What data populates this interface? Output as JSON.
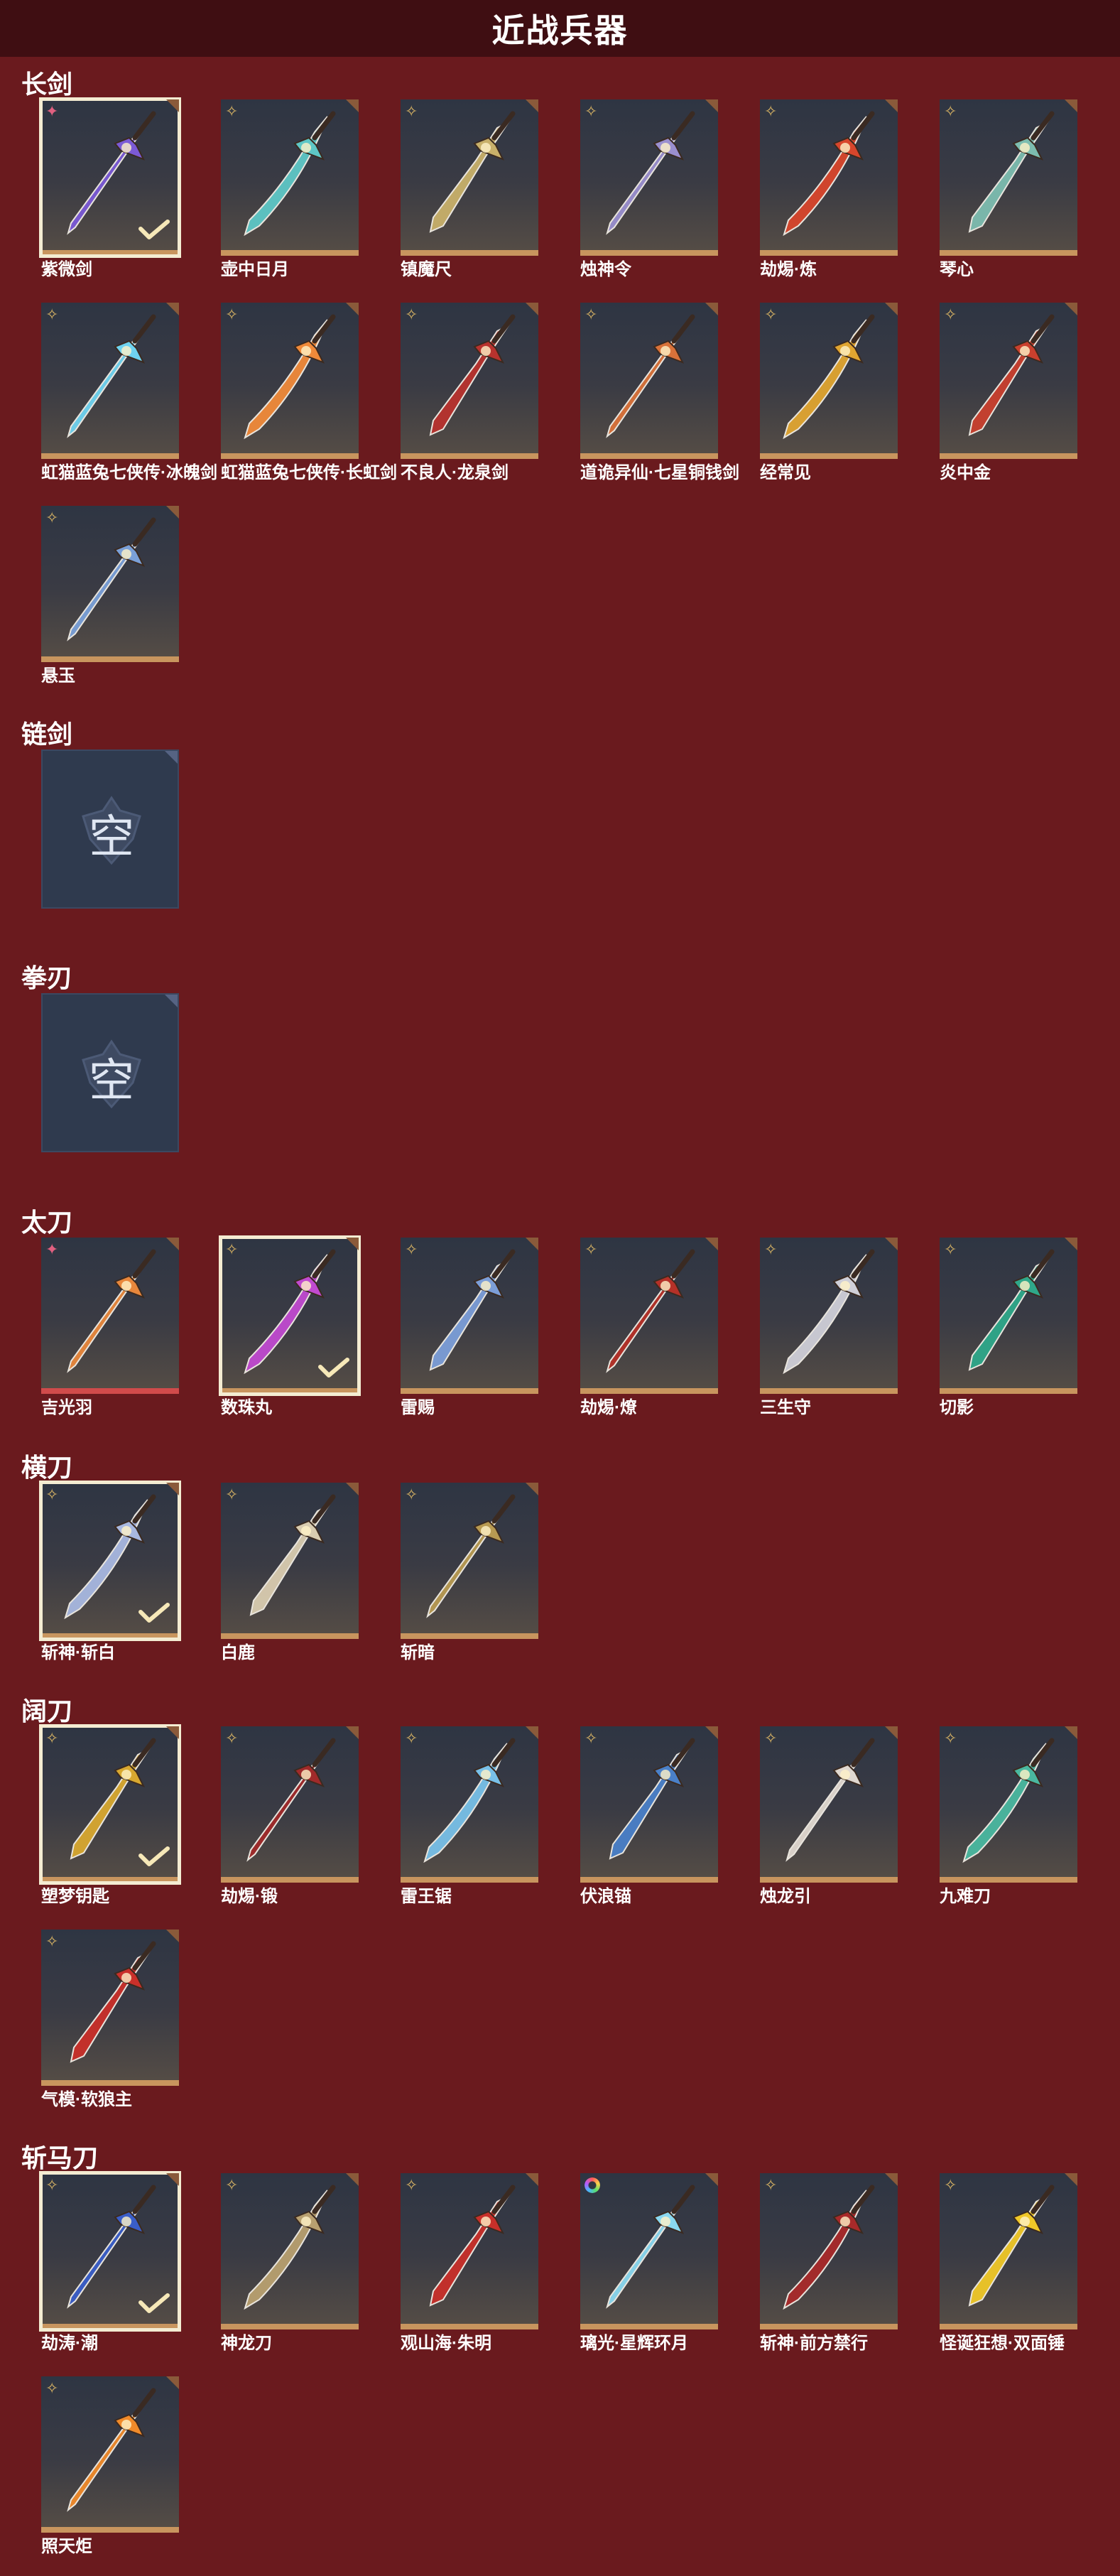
{
  "title": "近战兵器",
  "empty_text": "空",
  "categories": [
    {
      "label": "长剑",
      "items": [
        {
          "name": "紫微剑",
          "rarity": "pink",
          "selected": true,
          "color": "#7b5ad6"
        },
        {
          "name": "壶中日月",
          "rarity": "gold",
          "selected": false,
          "color": "#5ec7c6"
        },
        {
          "name": "镇魔尺",
          "rarity": "gold",
          "selected": false,
          "color": "#c8b06a"
        },
        {
          "name": "烛神令",
          "rarity": "gold",
          "selected": false,
          "color": "#9a8fcf"
        },
        {
          "name": "劫焬·炼",
          "rarity": "gold",
          "selected": false,
          "color": "#d8462c"
        },
        {
          "name": "琴心",
          "rarity": "gold",
          "selected": false,
          "color": "#7dbdb0"
        },
        {
          "name": "虹猫蓝兔七侠传·冰魄剑",
          "rarity": "gold",
          "selected": false,
          "color": "#6fd3f0"
        },
        {
          "name": "虹猫蓝兔七侠传·长虹剑",
          "rarity": "gold",
          "selected": false,
          "color": "#f08a3a"
        },
        {
          "name": "不良人·龙泉剑",
          "rarity": "gold",
          "selected": false,
          "color": "#b8332e"
        },
        {
          "name": "道诡异仙·七星铜钱剑",
          "rarity": "gold",
          "selected": false,
          "color": "#d9723a"
        },
        {
          "name": "经常见",
          "rarity": "gold",
          "selected": false,
          "color": "#e0a531"
        },
        {
          "name": "炎中金",
          "rarity": "gold",
          "selected": false,
          "color": "#c9402e"
        },
        {
          "name": "悬玉",
          "rarity": "gold",
          "selected": false,
          "color": "#7aa0d8"
        }
      ]
    },
    {
      "label": "链剑",
      "items": []
    },
    {
      "label": "拳刃",
      "items": []
    },
    {
      "label": "太刀",
      "items": [
        {
          "name": "吉光羽",
          "rarity": "pink",
          "selected": false,
          "color": "#e8873c",
          "redbar": true
        },
        {
          "name": "数珠丸",
          "rarity": "gold",
          "selected": true,
          "color": "#c04ad0"
        },
        {
          "name": "雷赐",
          "rarity": "gold",
          "selected": false,
          "color": "#7c9ed8"
        },
        {
          "name": "劫焬·燎",
          "rarity": "gold",
          "selected": false,
          "color": "#b53128"
        },
        {
          "name": "三生守",
          "rarity": "gold",
          "selected": false,
          "color": "#cfcfd8"
        },
        {
          "name": "切影",
          "rarity": "gold",
          "selected": false,
          "color": "#2fa88a"
        }
      ]
    },
    {
      "label": "横刀",
      "items": [
        {
          "name": "斩神·斩白",
          "rarity": "gold",
          "selected": true,
          "color": "#a8b8e0"
        },
        {
          "name": "白鹿",
          "rarity": "gold",
          "selected": false,
          "color": "#d9ccb0"
        },
        {
          "name": "斩暗",
          "rarity": "gold",
          "selected": false,
          "color": "#b89a52"
        }
      ]
    },
    {
      "label": "阔刀",
      "items": [
        {
          "name": "塑梦钥匙",
          "rarity": "gold",
          "selected": true,
          "color": "#d8a830"
        },
        {
          "name": "劫焬·锻",
          "rarity": "gold",
          "selected": false,
          "color": "#a02a2a"
        },
        {
          "name": "雷王锯",
          "rarity": "gold",
          "selected": false,
          "color": "#78c0e8"
        },
        {
          "name": "伏浪锚",
          "rarity": "gold",
          "selected": false,
          "color": "#4a80c8"
        },
        {
          "name": "烛龙引",
          "rarity": "gold",
          "selected": false,
          "color": "#e0d8d0"
        },
        {
          "name": "九难刀",
          "rarity": "gold",
          "selected": false,
          "color": "#4ab8a0"
        },
        {
          "name": "气模·软狼主",
          "rarity": "gold",
          "selected": false,
          "color": "#c9302a"
        }
      ]
    },
    {
      "label": "斩马刀",
      "items": [
        {
          "name": "劫涛·潮",
          "rarity": "gold",
          "selected": true,
          "color": "#3a5ec8"
        },
        {
          "name": "神龙刀",
          "rarity": "gold",
          "selected": false,
          "color": "#b8a070"
        },
        {
          "name": "观山海·朱明",
          "rarity": "gold",
          "selected": false,
          "color": "#c8302a"
        },
        {
          "name": "璃光·星辉环月",
          "rarity": "rainbow",
          "selected": false,
          "color": "#8ad8f0"
        },
        {
          "name": "斩神·前方禁行",
          "rarity": "gold",
          "selected": false,
          "color": "#a82a2a"
        },
        {
          "name": "怪诞狂想·双面锤",
          "rarity": "gold",
          "selected": false,
          "color": "#f0c828"
        },
        {
          "name": "照天炬",
          "rarity": "gold",
          "selected": false,
          "color": "#f08a2a"
        }
      ]
    }
  ]
}
